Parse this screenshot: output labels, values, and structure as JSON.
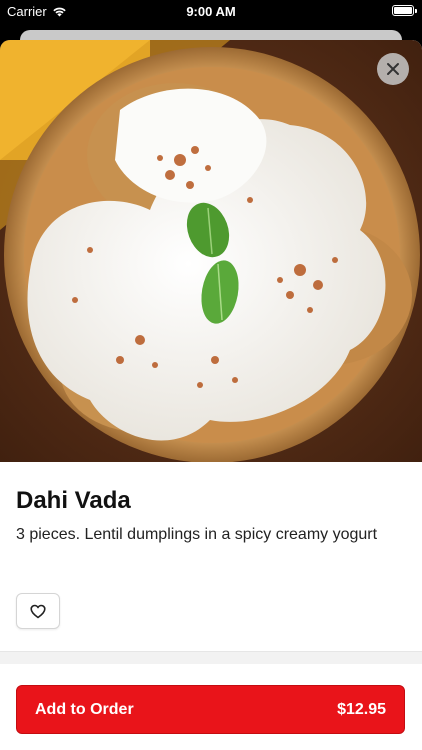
{
  "status_bar": {
    "carrier": "Carrier",
    "time": "9:00 AM"
  },
  "item": {
    "title": "Dahi Vada",
    "description": "3 pieces. Lentil dumplings in a spicy creamy yogurt"
  },
  "actions": {
    "add_label": "Add to Order",
    "price": "$12.95"
  },
  "colors": {
    "accent": "#e9141a"
  },
  "icons": {
    "close": "close-icon",
    "favorite": "heart-outline-icon",
    "wifi": "wifi-icon",
    "battery": "battery-icon"
  }
}
